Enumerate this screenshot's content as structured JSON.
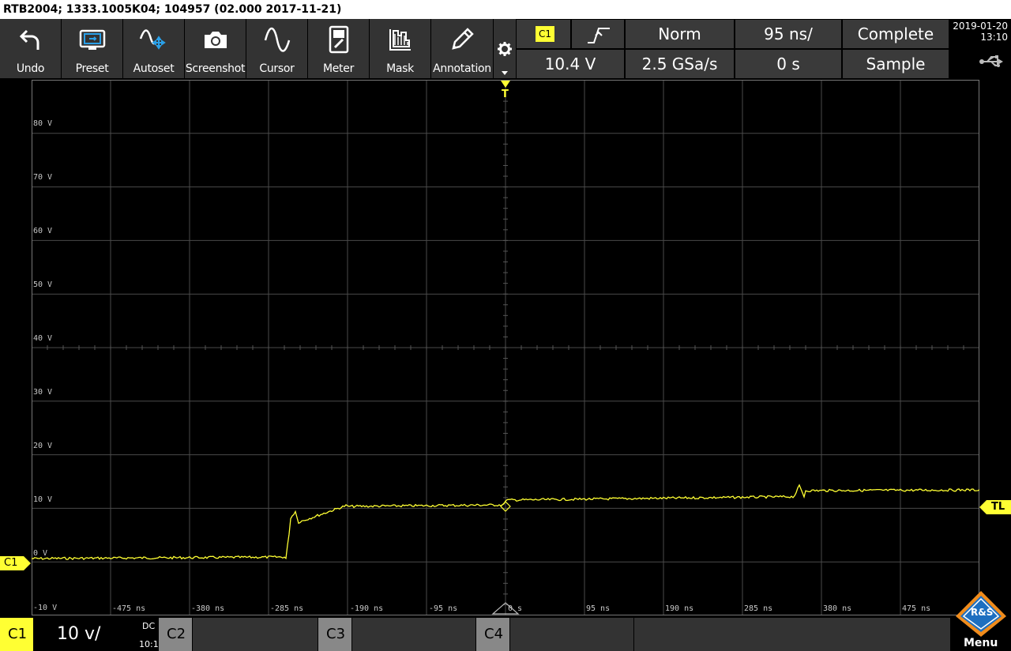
{
  "title": "RTB2004; 1333.1005K04; 104957 (02.000 2017-11-21)",
  "toolbar": [
    {
      "label": "Undo",
      "icon": "undo-icon"
    },
    {
      "label": "Preset",
      "icon": "preset-icon"
    },
    {
      "label": "Autoset",
      "icon": "autoset-icon"
    },
    {
      "label": "Screenshot",
      "icon": "camera-icon"
    },
    {
      "label": "Cursor",
      "icon": "cursor-icon"
    },
    {
      "label": "Meter",
      "icon": "meter-icon"
    },
    {
      "label": "Mask",
      "icon": "mask-icon"
    },
    {
      "label": "Annotation",
      "icon": "pencil-icon"
    }
  ],
  "trigger": {
    "source": "C1",
    "level": "10.4 V",
    "mode": "Norm",
    "timebase": "95 ns/",
    "sample_rate": "2.5 GSa/s",
    "position": "0 s",
    "acq_status": "Complete",
    "acq_mode": "Sample"
  },
  "datetime": {
    "date": "2019-01-20",
    "time": "13:10"
  },
  "y_labels": [
    "80 V",
    "70 V",
    "60 V",
    "50 V",
    "40 V",
    "30 V",
    "20 V",
    "10 V",
    "0 V",
    "-10 V"
  ],
  "x_labels": [
    "-475 ns",
    "-380 ns",
    "-285 ns",
    "-190 ns",
    "-95 ns",
    "0 s",
    "95 ns",
    "190 ns",
    "285 ns",
    "380 ns",
    "475 ns"
  ],
  "markers": {
    "trigger_top": "T",
    "trigger_level": "TL",
    "channel": "C1"
  },
  "channels": {
    "c1": {
      "name": "C1",
      "scale": "10 v/",
      "coupling": "DC",
      "probe": "10:1"
    },
    "c2": {
      "name": "C2"
    },
    "c3": {
      "name": "C3"
    },
    "c4": {
      "name": "C4"
    }
  },
  "menu_label": "Menu",
  "logo_text": "R&S",
  "colors": {
    "c1": "#ffff33",
    "toolbar": "#333333",
    "cell": "#3a3a3a",
    "grid": "#4a4a4a"
  }
}
